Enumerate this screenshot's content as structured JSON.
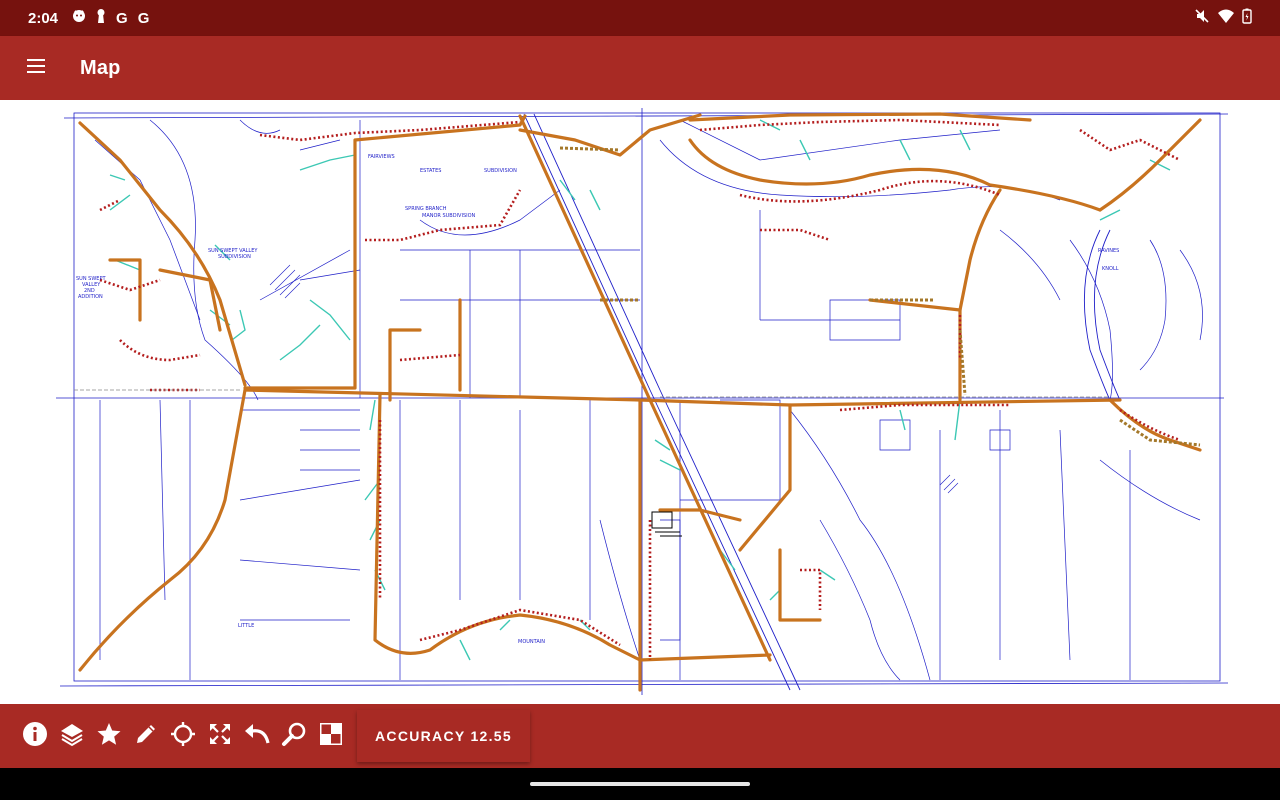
{
  "status_bar": {
    "time": "2:04",
    "left_glyphs": [
      "G",
      "G"
    ],
    "icons": [
      "cat-face-icon",
      "keyhole-icon",
      "mute-icon",
      "wifi-icon",
      "battery-icon"
    ]
  },
  "app_bar": {
    "title": "Map",
    "menu_icon": "menu-icon"
  },
  "map": {
    "labels": {
      "sun_swept_valley": "SUN SWEPT VALLEY",
      "subdivision_1": "SUBDIVISION",
      "sun_swept_valley_2nd": "SUN SWEPT",
      "valley": "VALLEY",
      "second": "2ND",
      "addition": "ADDITION",
      "fairview": "FAIRVIEWS",
      "estates": "ESTATES",
      "subdivision_2": "SUBDIVISION",
      "spring_branch": "SPRING BRANCH",
      "manor_subdivision": "MANOR SUBDIVISION",
      "little": "LITTLE",
      "mountain": "MOUNTAIN",
      "knoll": "KNOLL",
      "ravines": "RAVINES"
    },
    "colors": {
      "water_lines": "#c8731f",
      "parcels": "#1e1ec8",
      "services": "#3cc8b4",
      "dots": "#b41e1e"
    }
  },
  "toolbar": {
    "tools": [
      {
        "name": "info",
        "icon": "info-icon"
      },
      {
        "name": "layers",
        "icon": "layers-icon"
      },
      {
        "name": "favorites",
        "icon": "star-icon"
      },
      {
        "name": "edit",
        "icon": "pencil-icon"
      },
      {
        "name": "locate",
        "icon": "crosshair-icon"
      },
      {
        "name": "fullscreen",
        "icon": "expand-icon"
      },
      {
        "name": "undo",
        "icon": "undo-icon"
      },
      {
        "name": "search",
        "icon": "magnifier-icon"
      },
      {
        "name": "basemap",
        "icon": "grid-icon"
      }
    ],
    "accuracy_label": "ACCURACY 12.55"
  }
}
